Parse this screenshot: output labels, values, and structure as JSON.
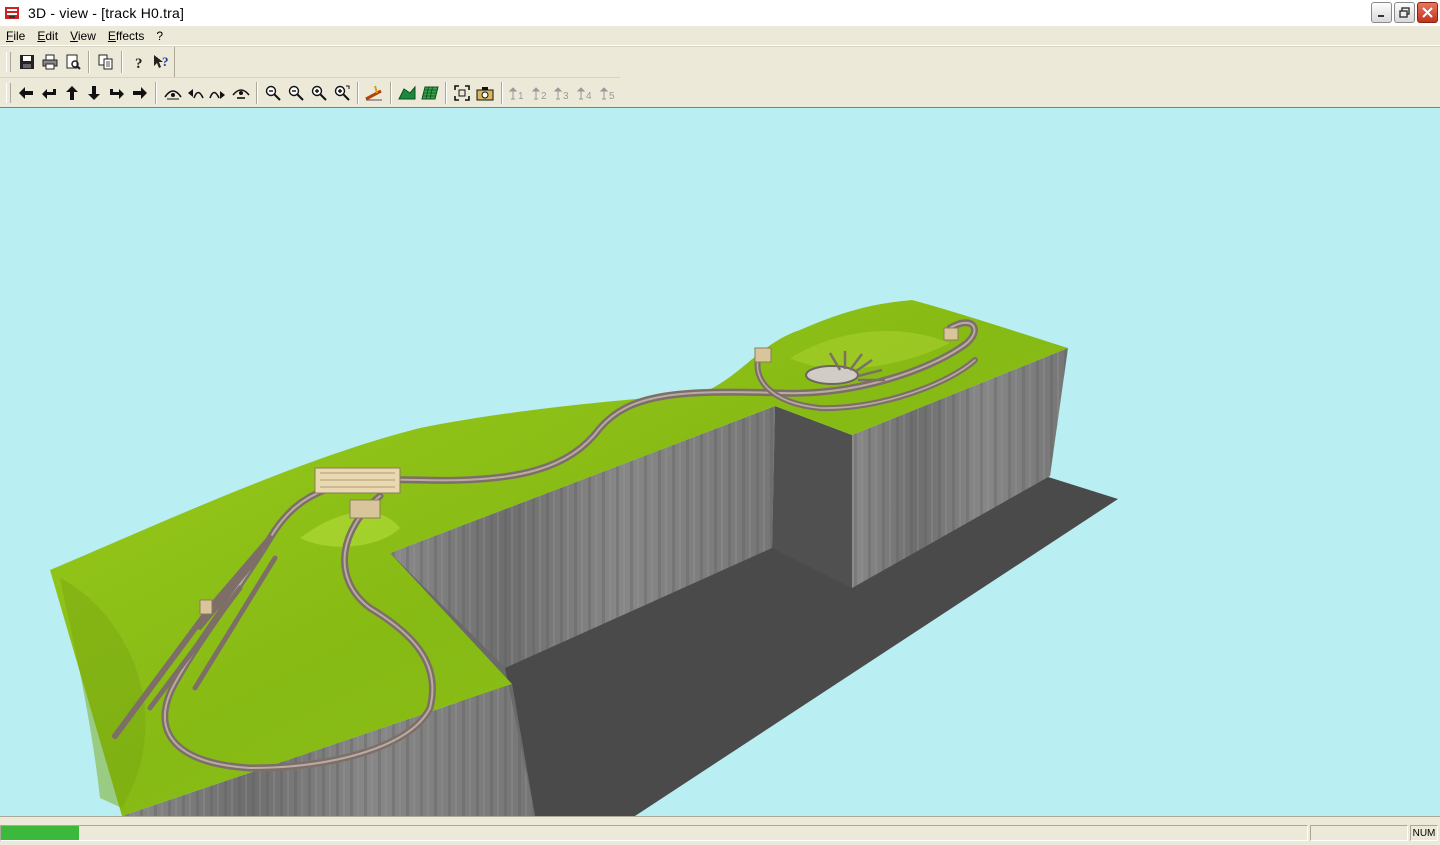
{
  "window": {
    "title": "3D - view - [track H0.tra]"
  },
  "menu": {
    "items": [
      "File",
      "Edit",
      "View",
      "Effects",
      "?"
    ],
    "underline": [
      "F",
      "E",
      "V",
      "E",
      ""
    ]
  },
  "toolbar1": [
    "save-icon",
    "print-icon",
    "print-preview-icon",
    "copy-icon",
    "help-icon",
    "context-help-icon"
  ],
  "toolbar2": [
    "arrow-left-icon",
    "turn-left-icon",
    "arrow-up-icon",
    "arrow-down-icon",
    "turn-right-icon",
    "arrow-right-icon",
    "tilt-up-icon",
    "tilt-left-icon",
    "tilt-right-icon",
    "tilt-down-icon",
    "zoom-out-icon",
    "zoom-out-small-icon",
    "zoom-in-small-icon",
    "zoom-in-icon",
    "track-tool-icon",
    "terrain-icon",
    "grid-icon",
    "fit-view-icon",
    "camera-icon",
    "viewpoint-1-icon",
    "viewpoint-2-icon",
    "viewpoint-3-icon",
    "viewpoint-4-icon",
    "viewpoint-5-icon"
  ],
  "viewpoints": [
    "1",
    "2",
    "3",
    "4",
    "5"
  ],
  "status": {
    "num": "NUM",
    "progress": 0.06
  },
  "colors": {
    "sky": "#b9eef2",
    "grass": "#8ec21a",
    "cliff": "#7b7b7b",
    "shadow": "#4a4a4a",
    "track": "#9c8e86"
  }
}
